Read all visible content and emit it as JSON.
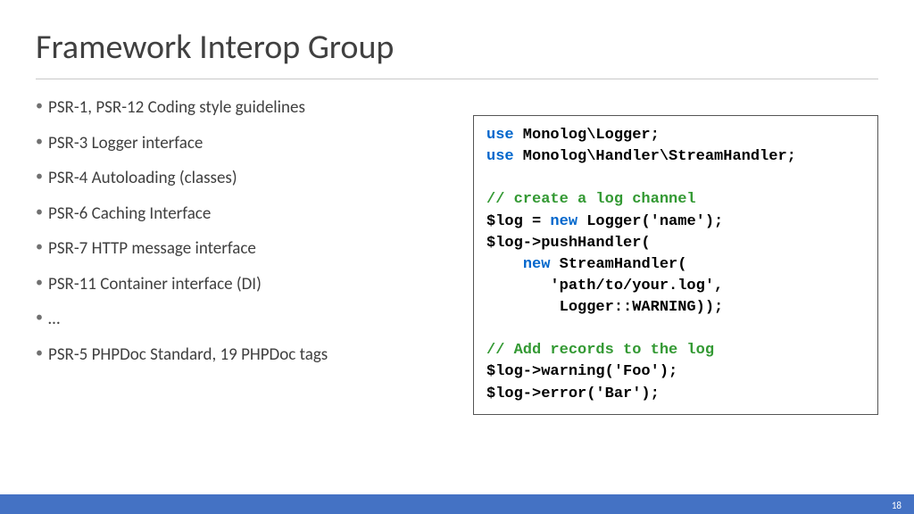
{
  "title": "Framework Interop Group",
  "bullets": [
    "PSR-1, PSR-12 Coding style guidelines",
    "PSR-3 Logger interface",
    "PSR-4 Autoloading (classes)",
    "PSR-6 Caching Interface",
    "PSR-7 HTTP message interface",
    "PSR-11 Container interface (DI)",
    "…",
    "PSR-5 PHPDoc Standard, 19 PHPDoc tags"
  ],
  "code": {
    "l1_kw": "use",
    "l1_rest": " Monolog\\Logger;",
    "l2_kw": "use",
    "l2_rest": " Monolog\\Handler\\StreamHandler;",
    "l3": "",
    "l4_comment": "// create a log channel",
    "l5a": "$log = ",
    "l5_kw": "new",
    "l5b": " Logger('name');",
    "l6": "$log->pushHandler(",
    "l7a": "    ",
    "l7_kw": "new",
    "l7b": " StreamHandler(",
    "l8": "       'path/to/your.log',",
    "l9": "        Logger::WARNING));",
    "l10": "",
    "l11_comment": "// Add records to the log",
    "l12": "$log->warning('Foo');",
    "l13": "$log->error('Bar');"
  },
  "page_number": "18"
}
